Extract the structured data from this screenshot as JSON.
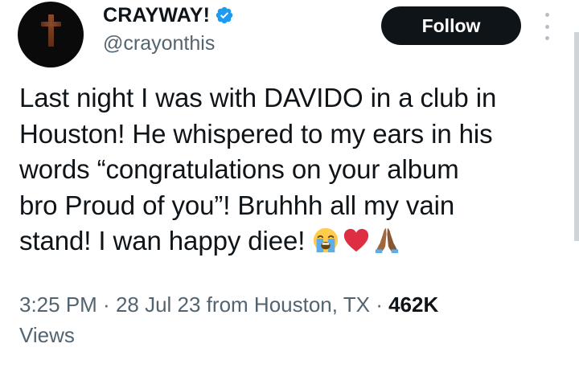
{
  "author": {
    "display_name": "CRAYWAY!",
    "handle": "@crayonthis",
    "verified": true,
    "avatar_icon": "dark-avatar-with-cross",
    "verified_icon": "verified-badge-icon",
    "verified_color": "#1d9bf0"
  },
  "actions": {
    "follow_label": "Follow",
    "more_icon": "vertical-ellipsis-icon"
  },
  "tweet": {
    "lines": [
      "Last night I was with DAVIDO in a club in",
      "Houston! He whispered to my ears in his",
      "words “congratulations on your album",
      "bro Proud of you”! Bruhhh all my vain",
      "stand! I wan happy diee!"
    ],
    "emojis": [
      "loudly-crying-face",
      "red-heart",
      "folded-hands"
    ]
  },
  "meta": {
    "time": "3:25 PM",
    "separator": " · ",
    "date": "28 Jul 23",
    "location": "from Houston, TX",
    "views_count": "462K",
    "views_label": "Views"
  },
  "colors": {
    "text_primary": "#0f1419",
    "text_secondary": "#536471",
    "button_bg": "#0f1419",
    "button_text": "#ffffff",
    "accent": "#1d9bf0"
  }
}
